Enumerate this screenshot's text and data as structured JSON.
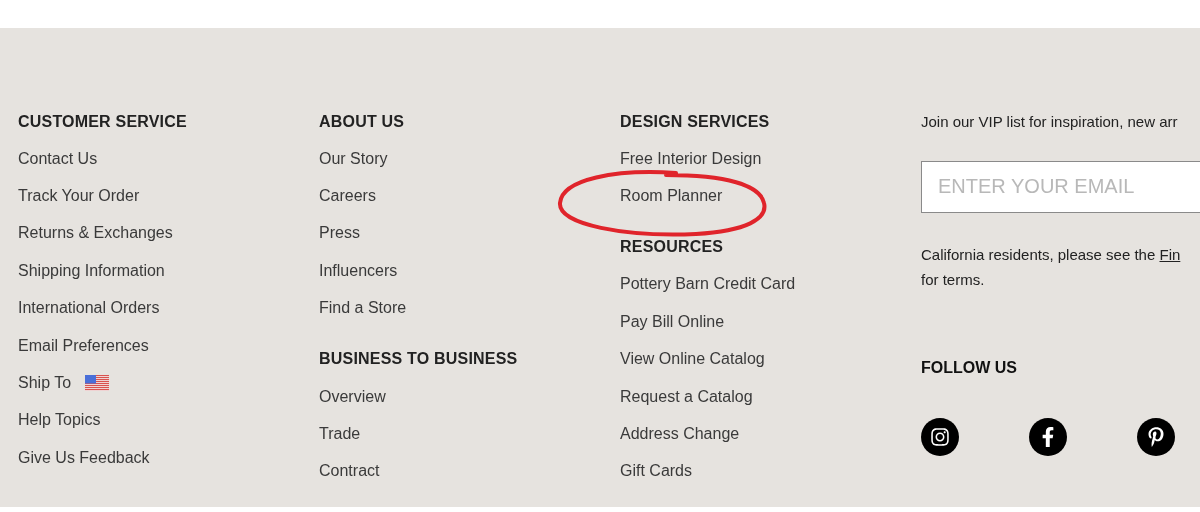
{
  "columns": [
    {
      "sections": [
        {
          "heading": "CUSTOMER SERVICE",
          "links": [
            {
              "label": "Contact Us",
              "kind": "text"
            },
            {
              "label": "Track Your Order",
              "kind": "text"
            },
            {
              "label": "Returns & Exchanges",
              "kind": "text"
            },
            {
              "label": "Shipping Information",
              "kind": "text"
            },
            {
              "label": "International Orders",
              "kind": "text"
            },
            {
              "label": "Email Preferences",
              "kind": "text"
            },
            {
              "label": "Ship To",
              "kind": "flag"
            },
            {
              "label": "Help Topics",
              "kind": "text"
            },
            {
              "label": "Give Us Feedback",
              "kind": "text"
            }
          ]
        }
      ]
    },
    {
      "sections": [
        {
          "heading": "ABOUT US",
          "links": [
            {
              "label": "Our Story",
              "kind": "text"
            },
            {
              "label": "Careers",
              "kind": "text"
            },
            {
              "label": "Press",
              "kind": "text"
            },
            {
              "label": "Influencers",
              "kind": "text"
            },
            {
              "label": "Find a Store",
              "kind": "text"
            }
          ]
        },
        {
          "heading": "BUSINESS TO BUSINESS",
          "links": [
            {
              "label": "Overview",
              "kind": "text"
            },
            {
              "label": "Trade",
              "kind": "text"
            },
            {
              "label": "Contract",
              "kind": "text"
            }
          ]
        }
      ]
    },
    {
      "sections": [
        {
          "heading": "DESIGN SERVICES",
          "links": [
            {
              "label": "Free Interior Design",
              "kind": "text"
            },
            {
              "label": "Room Planner",
              "kind": "text"
            }
          ]
        },
        {
          "heading": "RESOURCES",
          "links": [
            {
              "label": "Pottery Barn Credit Card",
              "kind": "text"
            },
            {
              "label": "Pay Bill Online",
              "kind": "text"
            },
            {
              "label": "View Online Catalog",
              "kind": "text"
            },
            {
              "label": "Request a Catalog",
              "kind": "text"
            },
            {
              "label": "Address Change",
              "kind": "text"
            },
            {
              "label": "Gift Cards",
              "kind": "text"
            }
          ]
        }
      ]
    }
  ],
  "newsletter": {
    "intro": "Join our VIP list for inspiration, new arr",
    "email": {
      "placeholder": "ENTER YOUR EMAIL"
    },
    "legal_before": "California residents, please see the ",
    "legal_link": "Fin",
    "legal_after": "for terms."
  },
  "follow": {
    "heading": "FOLLOW US",
    "networks": [
      {
        "kind": "instagram"
      },
      {
        "kind": "facebook"
      },
      {
        "kind": "pinterest"
      }
    ]
  }
}
